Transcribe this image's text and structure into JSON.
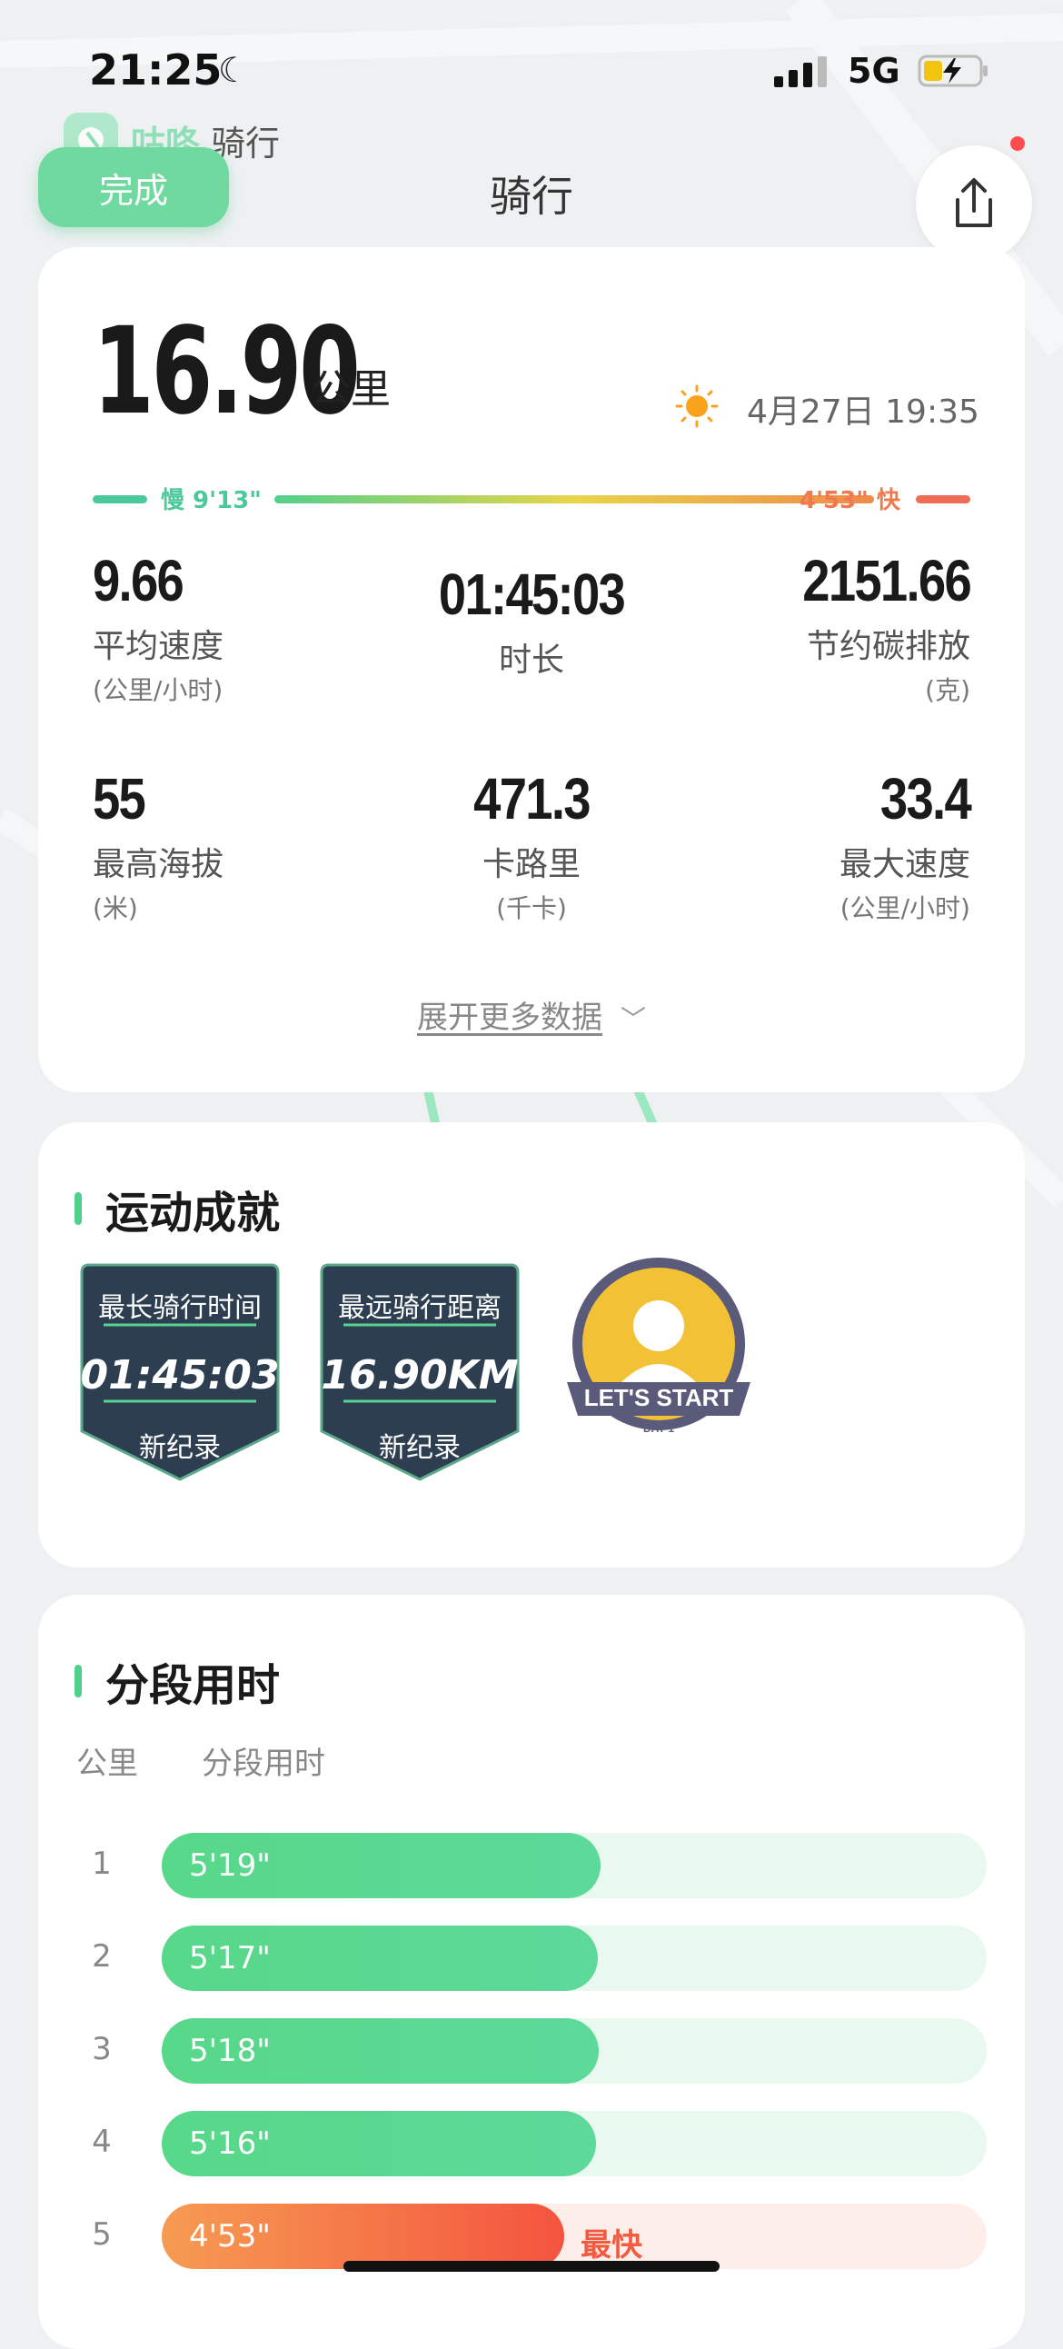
{
  "status_bar": {
    "time": "21:25",
    "network": "5G"
  },
  "brand": {
    "name": "咕咚",
    "sub": "骑行"
  },
  "nav": {
    "done": "完成",
    "title": "骑行"
  },
  "summary": {
    "distance": "16.90",
    "distance_unit": "公里",
    "datetime": "4月27日 19:35",
    "pace_slow": "慢 9'13\"",
    "pace_fast": "4'53\" 快",
    "stats": [
      {
        "value": "9.66",
        "label": "平均速度",
        "unit": "(公里/小时)"
      },
      {
        "value": "01:45:03",
        "label": "时长",
        "unit": ""
      },
      {
        "value": "2151.66",
        "label": "节约碳排放",
        "unit": "(克)"
      },
      {
        "value": "55",
        "label": "最高海拔",
        "unit": "(米)"
      },
      {
        "value": "471.3",
        "label": "卡路里",
        "unit": "(千卡)"
      },
      {
        "value": "33.4",
        "label": "最大速度",
        "unit": "(公里/小时)"
      }
    ],
    "expand": "展开更多数据"
  },
  "achievements": {
    "title": "运动成就",
    "medals": [
      {
        "title": "最长骑行时间",
        "value": "01:45:03",
        "record": "新纪录"
      },
      {
        "title": "最远骑行距离",
        "value": "16.90KM",
        "record": "新纪录"
      }
    ],
    "badge": {
      "text": "LET'S START",
      "sub": "DAY 1"
    }
  },
  "splits": {
    "title": "分段用时",
    "col_km": "公里",
    "col_time": "分段用时",
    "fastest_tag": "最快",
    "rows": [
      {
        "km": "1",
        "time": "5'19\"",
        "seconds": 319,
        "fastest": false
      },
      {
        "km": "2",
        "time": "5'17\"",
        "seconds": 317,
        "fastest": false
      },
      {
        "km": "3",
        "time": "5'18\"",
        "seconds": 318,
        "fastest": false
      },
      {
        "km": "4",
        "time": "5'16\"",
        "seconds": 316,
        "fastest": false
      },
      {
        "km": "5",
        "time": "4'53\"",
        "seconds": 293,
        "fastest": true
      }
    ]
  },
  "colors": {
    "accent": "#50d08f",
    "fast": "#f4543f",
    "slow": "#4cc99a"
  }
}
